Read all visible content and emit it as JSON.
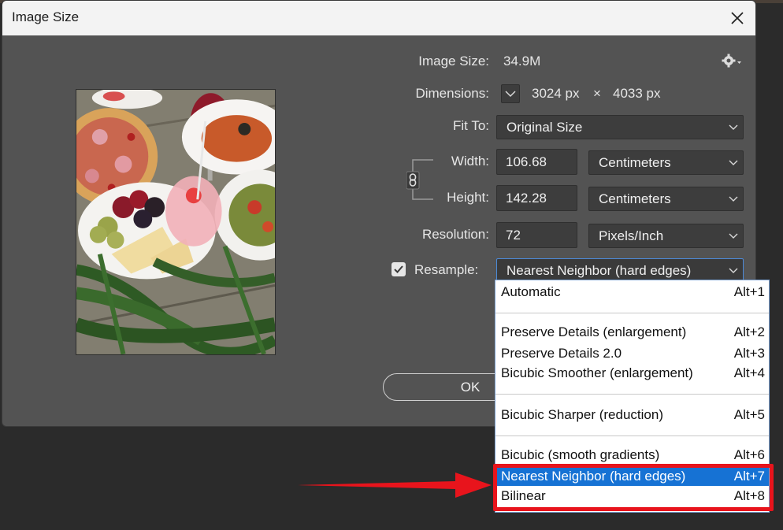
{
  "dialog": {
    "title": "Image Size",
    "image_size_label": "Image Size:",
    "image_size_value": "34.9M",
    "dimensions_label": "Dimensions:",
    "dim_width": "3024 px",
    "dim_times": "×",
    "dim_height": "4033 px",
    "fit_to_label": "Fit To:",
    "fit_to_value": "Original Size",
    "width_label": "Width:",
    "width_value": "106.68",
    "width_unit": "Centimeters",
    "height_label": "Height:",
    "height_value": "142.28",
    "height_unit": "Centimeters",
    "resolution_label": "Resolution:",
    "resolution_value": "72",
    "resolution_unit": "Pixels/Inch",
    "resample_label": "Resample:",
    "resample_checked": true,
    "resample_value": "Nearest Neighbor (hard edges)",
    "ok_label": "OK"
  },
  "resample_menu": [
    {
      "name": "Automatic",
      "shortcut": "Alt+1"
    },
    {
      "name": "Preserve Details (enlargement)",
      "shortcut": "Alt+2"
    },
    {
      "name": "Preserve Details 2.0",
      "shortcut": "Alt+3"
    },
    {
      "name": "Bicubic Smoother (enlargement)",
      "shortcut": "Alt+4"
    },
    {
      "name": "Bicubic Sharper (reduction)",
      "shortcut": "Alt+5"
    },
    {
      "name": "Bicubic (smooth gradients)",
      "shortcut": "Alt+6"
    },
    {
      "name": "Nearest Neighbor (hard edges)",
      "shortcut": "Alt+7",
      "selected": true
    },
    {
      "name": "Bilinear",
      "shortcut": "Alt+8"
    }
  ],
  "icons": {
    "close": "close-icon",
    "gear": "gear-icon",
    "link": "chain-link-icon",
    "checkbox": "checkmark-icon",
    "caret": "chevron-down-icon",
    "arrow": "red-arrow-icon"
  },
  "colors": {
    "dialog_bg": "#535353",
    "titlebar_bg": "#f3f3f3",
    "field_bg": "#3d3d3d",
    "selection": "#1672d4",
    "annotation": "#e8141c"
  }
}
